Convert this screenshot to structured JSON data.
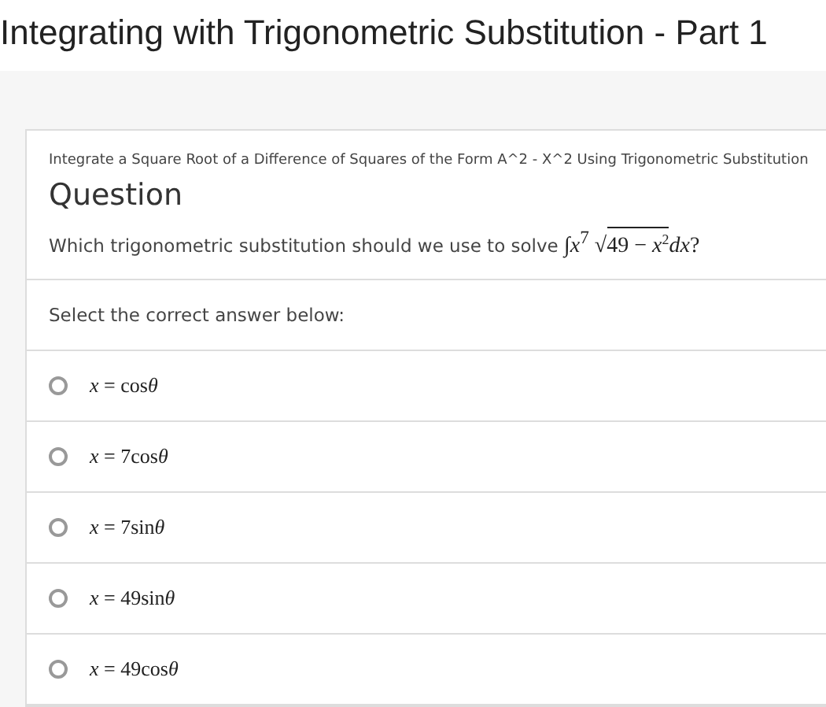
{
  "page_title": "Integrating with Trigonometric Substitution - Part 1",
  "topic": "Integrate a Square Root of a Difference of Squares of the Form A^2 - X^2 Using Trigonometric Substitution",
  "heading": "Question",
  "question": {
    "text": "Which trigonometric substitution should we use to solve",
    "integral_sign": "∫",
    "integrand": "*x*$^{7}$",
    "root_sign": "√",
    "radicand": "49 − *x*$^{2}$",
    "tail": "*dx*?"
  },
  "prompt": "Select the correct answer below:",
  "options": [
    {
      "variable": "x",
      "relation": "=",
      "function": "cos",
      "angle": "θ",
      "selected": false
    },
    {
      "variable": "x",
      "relation": "=",
      "function": "7cos",
      "angle": "θ",
      "selected": false
    },
    {
      "variable": "x",
      "relation": "=",
      "function": "7sin",
      "angle": "θ",
      "selected": false
    },
    {
      "variable": "x",
      "relation": "=",
      "function": "49sin",
      "angle": "θ",
      "selected": false
    },
    {
      "variable": "x",
      "relation": "=",
      "function": "49cos",
      "angle": "θ",
      "selected": false
    }
  ]
}
